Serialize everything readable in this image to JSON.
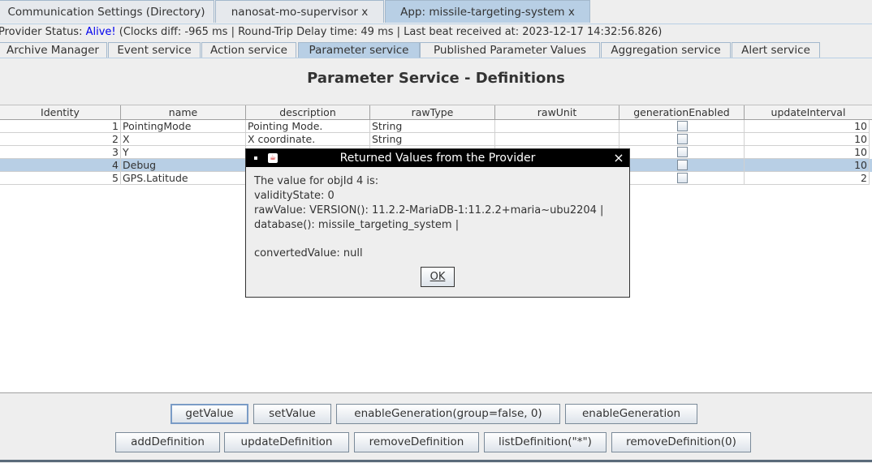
{
  "top_tabs": [
    {
      "label": "Communication Settings (Directory)"
    },
    {
      "label": "nanosat-mo-supervisor x"
    },
    {
      "label": "App: missile-targeting-system x"
    }
  ],
  "status": {
    "prefix": "Provider Status: ",
    "state": "Alive!",
    "details": " (Clocks diff: -965 ms | Round-Trip Delay time: 49 ms | Last beat received at: 2023-12-17 14:32:56.826)"
  },
  "service_tabs": [
    {
      "label": "Archive Manager"
    },
    {
      "label": "Event service"
    },
    {
      "label": "Action service"
    },
    {
      "label": "Parameter service"
    },
    {
      "label": "Published Parameter Values"
    },
    {
      "label": "Aggregation service"
    },
    {
      "label": "Alert service"
    }
  ],
  "page_title": "Parameter Service - Definitions",
  "table": {
    "columns": [
      "Identity",
      "name",
      "description",
      "rawType",
      "rawUnit",
      "generationEnabled",
      "updateInterval"
    ],
    "rows": [
      {
        "identity": "1",
        "name": "PointingMode",
        "description": "Pointing Mode.",
        "rawType": "String",
        "rawUnit": "",
        "generationEnabled": false,
        "updateInterval": "10"
      },
      {
        "identity": "2",
        "name": "X",
        "description": "X coordinate.",
        "rawType": "String",
        "rawUnit": "",
        "generationEnabled": false,
        "updateInterval": "10"
      },
      {
        "identity": "3",
        "name": "Y",
        "description": "",
        "rawType": "",
        "rawUnit": "",
        "generationEnabled": false,
        "updateInterval": "10"
      },
      {
        "identity": "4",
        "name": "Debug",
        "description": "",
        "rawType": "",
        "rawUnit": "",
        "generationEnabled": false,
        "updateInterval": "10",
        "selected": true
      },
      {
        "identity": "5",
        "name": "GPS.Latitude",
        "description": "",
        "rawType": "",
        "rawUnit": "",
        "generationEnabled": false,
        "updateInterval": "2"
      }
    ]
  },
  "buttons_row1": [
    {
      "label": "getValue"
    },
    {
      "label": "setValue"
    },
    {
      "label": "enableGeneration(group=false, 0)"
    },
    {
      "label": "enableGeneration"
    }
  ],
  "buttons_row2": [
    {
      "label": "addDefinition"
    },
    {
      "label": "updateDefinition"
    },
    {
      "label": "removeDefinition"
    },
    {
      "label": "listDefinition(\"*\")"
    },
    {
      "label": "removeDefinition(0)"
    }
  ],
  "dialog": {
    "title": "Returned Values from the Provider",
    "lines": [
      "The value for objId 4 is:",
      "validityState: 0",
      "rawValue: VERSION(): 11.2.2-MariaDB-1:11.2.2+maria~ubu2204 |",
      "database(): missile_targeting_system |",
      "",
      "convertedValue: null"
    ],
    "ok_label": "OK",
    "close_glyph": "×"
  }
}
